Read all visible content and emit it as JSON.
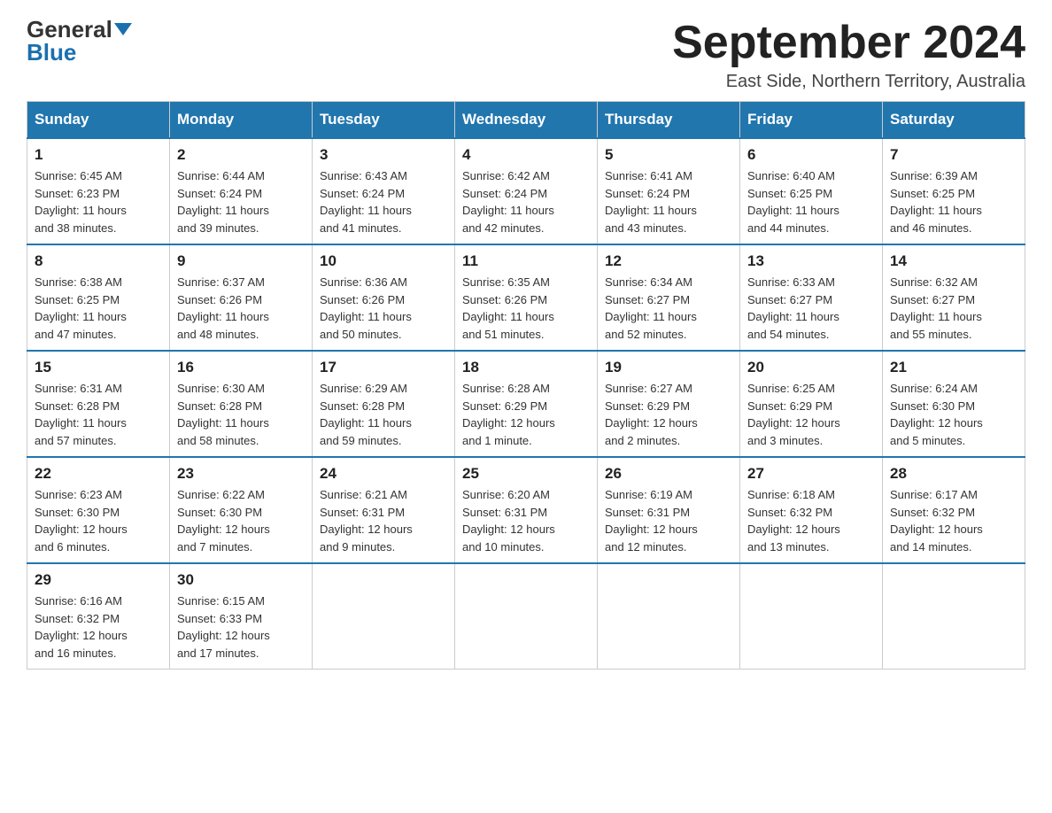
{
  "logo": {
    "general": "General",
    "blue": "Blue"
  },
  "title": "September 2024",
  "subtitle": "East Side, Northern Territory, Australia",
  "days": [
    "Sunday",
    "Monday",
    "Tuesday",
    "Wednesday",
    "Thursday",
    "Friday",
    "Saturday"
  ],
  "weeks": [
    [
      {
        "num": "1",
        "sunrise": "6:45 AM",
        "sunset": "6:23 PM",
        "daylight": "11 hours and 38 minutes."
      },
      {
        "num": "2",
        "sunrise": "6:44 AM",
        "sunset": "6:24 PM",
        "daylight": "11 hours and 39 minutes."
      },
      {
        "num": "3",
        "sunrise": "6:43 AM",
        "sunset": "6:24 PM",
        "daylight": "11 hours and 41 minutes."
      },
      {
        "num": "4",
        "sunrise": "6:42 AM",
        "sunset": "6:24 PM",
        "daylight": "11 hours and 42 minutes."
      },
      {
        "num": "5",
        "sunrise": "6:41 AM",
        "sunset": "6:24 PM",
        "daylight": "11 hours and 43 minutes."
      },
      {
        "num": "6",
        "sunrise": "6:40 AM",
        "sunset": "6:25 PM",
        "daylight": "11 hours and 44 minutes."
      },
      {
        "num": "7",
        "sunrise": "6:39 AM",
        "sunset": "6:25 PM",
        "daylight": "11 hours and 46 minutes."
      }
    ],
    [
      {
        "num": "8",
        "sunrise": "6:38 AM",
        "sunset": "6:25 PM",
        "daylight": "11 hours and 47 minutes."
      },
      {
        "num": "9",
        "sunrise": "6:37 AM",
        "sunset": "6:26 PM",
        "daylight": "11 hours and 48 minutes."
      },
      {
        "num": "10",
        "sunrise": "6:36 AM",
        "sunset": "6:26 PM",
        "daylight": "11 hours and 50 minutes."
      },
      {
        "num": "11",
        "sunrise": "6:35 AM",
        "sunset": "6:26 PM",
        "daylight": "11 hours and 51 minutes."
      },
      {
        "num": "12",
        "sunrise": "6:34 AM",
        "sunset": "6:27 PM",
        "daylight": "11 hours and 52 minutes."
      },
      {
        "num": "13",
        "sunrise": "6:33 AM",
        "sunset": "6:27 PM",
        "daylight": "11 hours and 54 minutes."
      },
      {
        "num": "14",
        "sunrise": "6:32 AM",
        "sunset": "6:27 PM",
        "daylight": "11 hours and 55 minutes."
      }
    ],
    [
      {
        "num": "15",
        "sunrise": "6:31 AM",
        "sunset": "6:28 PM",
        "daylight": "11 hours and 57 minutes."
      },
      {
        "num": "16",
        "sunrise": "6:30 AM",
        "sunset": "6:28 PM",
        "daylight": "11 hours and 58 minutes."
      },
      {
        "num": "17",
        "sunrise": "6:29 AM",
        "sunset": "6:28 PM",
        "daylight": "11 hours and 59 minutes."
      },
      {
        "num": "18",
        "sunrise": "6:28 AM",
        "sunset": "6:29 PM",
        "daylight": "12 hours and 1 minute."
      },
      {
        "num": "19",
        "sunrise": "6:27 AM",
        "sunset": "6:29 PM",
        "daylight": "12 hours and 2 minutes."
      },
      {
        "num": "20",
        "sunrise": "6:25 AM",
        "sunset": "6:29 PM",
        "daylight": "12 hours and 3 minutes."
      },
      {
        "num": "21",
        "sunrise": "6:24 AM",
        "sunset": "6:30 PM",
        "daylight": "12 hours and 5 minutes."
      }
    ],
    [
      {
        "num": "22",
        "sunrise": "6:23 AM",
        "sunset": "6:30 PM",
        "daylight": "12 hours and 6 minutes."
      },
      {
        "num": "23",
        "sunrise": "6:22 AM",
        "sunset": "6:30 PM",
        "daylight": "12 hours and 7 minutes."
      },
      {
        "num": "24",
        "sunrise": "6:21 AM",
        "sunset": "6:31 PM",
        "daylight": "12 hours and 9 minutes."
      },
      {
        "num": "25",
        "sunrise": "6:20 AM",
        "sunset": "6:31 PM",
        "daylight": "12 hours and 10 minutes."
      },
      {
        "num": "26",
        "sunrise": "6:19 AM",
        "sunset": "6:31 PM",
        "daylight": "12 hours and 12 minutes."
      },
      {
        "num": "27",
        "sunrise": "6:18 AM",
        "sunset": "6:32 PM",
        "daylight": "12 hours and 13 minutes."
      },
      {
        "num": "28",
        "sunrise": "6:17 AM",
        "sunset": "6:32 PM",
        "daylight": "12 hours and 14 minutes."
      }
    ],
    [
      {
        "num": "29",
        "sunrise": "6:16 AM",
        "sunset": "6:32 PM",
        "daylight": "12 hours and 16 minutes."
      },
      {
        "num": "30",
        "sunrise": "6:15 AM",
        "sunset": "6:33 PM",
        "daylight": "12 hours and 17 minutes."
      },
      null,
      null,
      null,
      null,
      null
    ]
  ],
  "labels": {
    "sunrise": "Sunrise:",
    "sunset": "Sunset:",
    "daylight": "Daylight:"
  }
}
